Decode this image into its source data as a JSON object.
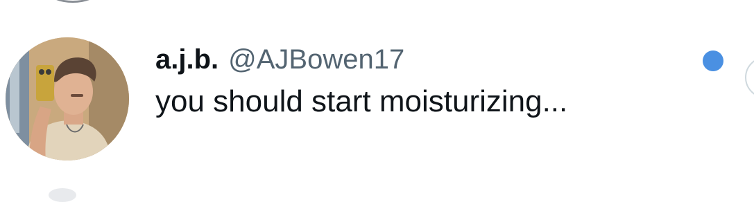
{
  "message_item": {
    "display_name": "a.j.b.",
    "handle": "@AJBowen17",
    "text": "you should start moisturizing...",
    "unread": true
  },
  "colors": {
    "unread_dot": "#4a90e2",
    "name": "#0f1419",
    "handle": "#536471",
    "text": "#0f1419",
    "background": "#ffffff"
  },
  "icons": {
    "avatar": "profile-photo-avatar",
    "unread": "unread-dot-icon"
  }
}
